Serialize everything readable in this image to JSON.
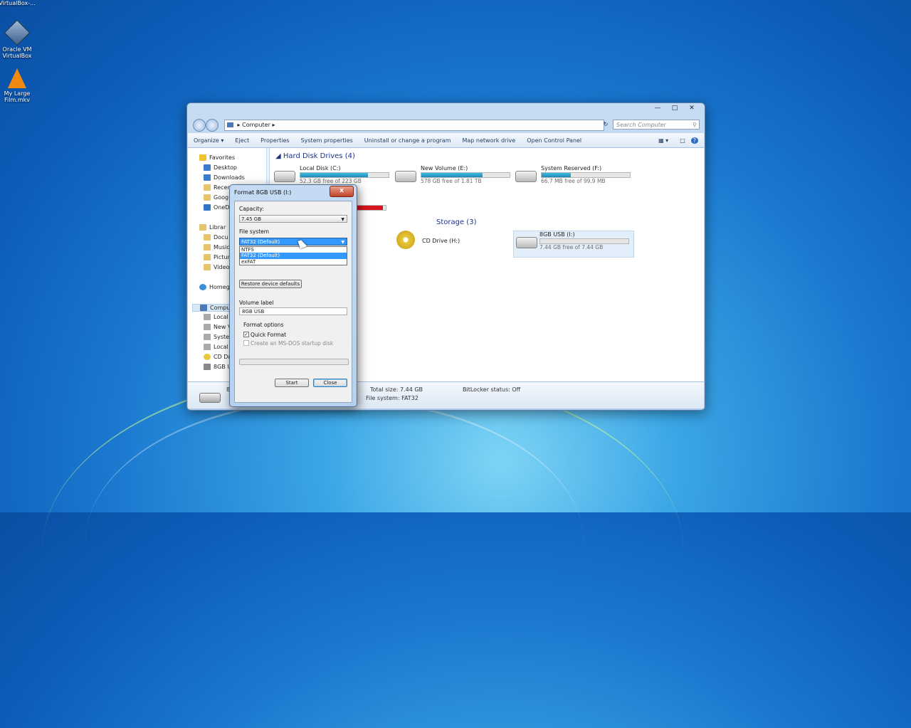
{
  "desktop": {
    "icons": [
      {
        "label": "VirtualBox-..."
      },
      {
        "label": "Oracle VM VirtualBox"
      },
      {
        "label": "My Large Film.mkv"
      }
    ]
  },
  "explorer": {
    "address": "Computer",
    "search_placeholder": "Search Computer",
    "toolbar": [
      "Organize",
      "Eject",
      "Properties",
      "System properties",
      "Uninstall or change a program",
      "Map network drive",
      "Open Control Panel"
    ],
    "sidebar": {
      "favorites": "Favorites",
      "fav_items": [
        "Desktop",
        "Downloads",
        "Recent",
        "Goog",
        "OneD"
      ],
      "libraries": "Librar",
      "lib_items": [
        "Docu",
        "Music",
        "Pictur",
        "Video"
      ],
      "homegroup": "Homeg",
      "computer": "Comput",
      "comp_items": [
        "Local",
        "New V",
        "Syster",
        "Local",
        "CD Dr",
        "8GB U"
      ]
    },
    "groups": {
      "hdd": "Hard Disk Drives (4)",
      "removable": "Storage (3)"
    },
    "drives": [
      {
        "name": "Local Disk (C:)",
        "free": "52.3 GB free of 223 GB",
        "fill": 0.77
      },
      {
        "name": "New Volume (E:)",
        "free": "578 GB free of 1.81 TB",
        "fill": 0.69
      },
      {
        "name": "System Reserved (F:)",
        "free": "66.7 MB free of 99.9 MB",
        "fill": 0.33
      },
      {
        "name": "CD Drive (H:)",
        "free": ""
      },
      {
        "name": "8GB USB (I:)",
        "free": "7.44 GB free of 7.44 GB",
        "fill": 0.0
      }
    ],
    "details": {
      "partial_label": "8",
      "total_size": "Total size: 7.44 GB",
      "file_system": "File system: FAT32",
      "bitlocker": "BitLocker status: Off"
    }
  },
  "format_dialog": {
    "title": "Format 8GB USB (I:)",
    "close_x": "x",
    "capacity_label": "Capacity:",
    "capacity_value": "7.45 GB",
    "fs_label": "File system",
    "fs_value": "FAT32 (Default)",
    "fs_options": [
      "NTFS",
      "FAT32 (Default)",
      "exFAT"
    ],
    "restore_button": "Restore device defaults",
    "volume_label": "Volume label",
    "volume_value": "8GB USB",
    "format_options": "Format options",
    "quick_format": "Quick Format",
    "quick_format_checked": true,
    "msdos_disk": "Create an MS-DOS startup disk",
    "progress": 0,
    "start_button": "Start",
    "close_button": "Close"
  }
}
